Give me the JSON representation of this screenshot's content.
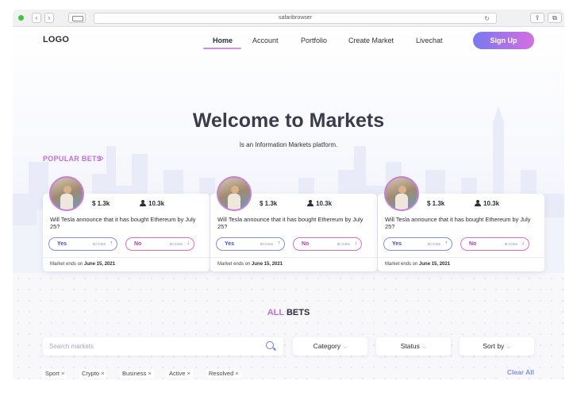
{
  "browser": {
    "address": "safaribrowser",
    "back_label": "‹",
    "forward_label": "›",
    "reload_label": "↻",
    "share_label": "⇪",
    "tabs_label": "⧉"
  },
  "header": {
    "logo": "LOGO",
    "nav": [
      "Home",
      "Account",
      "Portfolio",
      "Create Market",
      "Livechat"
    ],
    "signup": "Sign Up"
  },
  "hero": {
    "title": "Welcome to Markets",
    "subtitle": "Is an Information Markets platform."
  },
  "popular": {
    "label": "POPULAR BETS",
    "chevron": "»"
  },
  "cards": [
    {
      "volume": "$ 1.3k",
      "users": "10.3k",
      "question": "Will Tesla announce that it has bought Ethereum by July 25?",
      "yes_label": "Yes",
      "yes_price": "$0.0455",
      "yes_arrow": "↑",
      "no_label": "No",
      "no_price": "$0.0455",
      "no_arrow": "↓",
      "ends_prefix": "Market ends on",
      "ends_date": "June 15, 2021"
    },
    {
      "volume": "$ 1.3k",
      "users": "10.3k",
      "question": "Will Tesla announce that it has bought Ethereum by July 25?",
      "yes_label": "Yes",
      "yes_price": "$0.0455",
      "yes_arrow": "↑",
      "no_label": "No",
      "no_price": "$0.0455",
      "no_arrow": "↓",
      "ends_prefix": "Market ends on",
      "ends_date": "June 15, 2021"
    },
    {
      "volume": "$ 1.3k",
      "users": "10.3k",
      "question": "Will Tesla announce that it has bought Ethereum by July 25?",
      "yes_label": "Yes",
      "yes_price": "$0.0455",
      "yes_arrow": "↑",
      "no_label": "No",
      "no_price": "$0.0455",
      "no_arrow": "↓",
      "ends_prefix": "Market ends on",
      "ends_date": "June 15, 2021"
    }
  ],
  "all_bets": {
    "title_accent": "ALL",
    "title_rest": "BETS",
    "search_placeholder": "Search markets",
    "dropdowns": [
      "Category",
      "Status",
      "Sort by"
    ],
    "dropdown_chevron": "⌵",
    "chips": [
      "Sport",
      "Crypto",
      "Business",
      "Active",
      "Resolved"
    ],
    "chip_remove": "×",
    "clear_all": "Clear All"
  },
  "colors": {
    "accent_purple": "#c06fd9",
    "accent_blue": "#7f8ef2",
    "yes_color": "#3e4fcf",
    "no_color": "#b63aa3",
    "signup_gradient_start": "#7a79f0",
    "signup_gradient_end": "#d56ee1",
    "traffic_green": "#3fc43b"
  }
}
